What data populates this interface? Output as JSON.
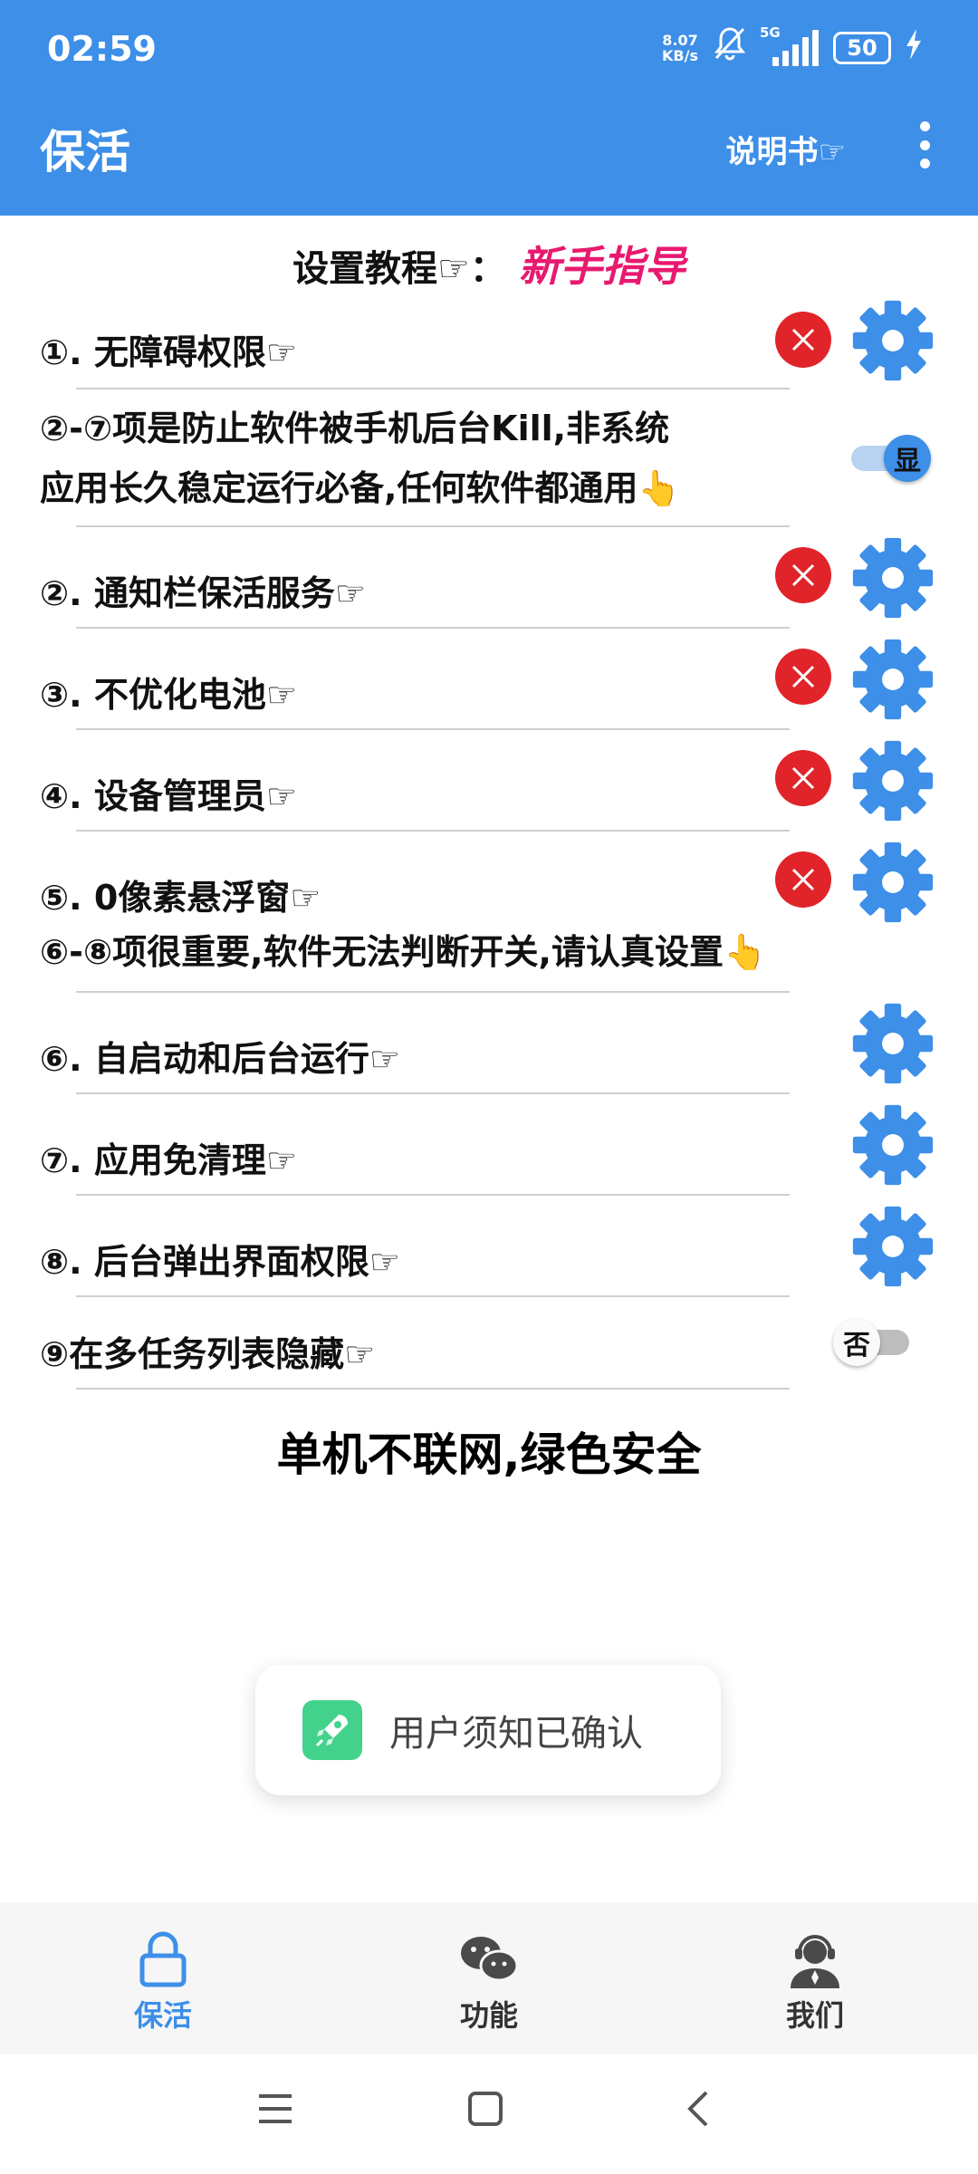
{
  "status": {
    "time": "02:59",
    "net_speed": "8.07",
    "net_unit": "KB/s",
    "signal_label": "5G",
    "battery": "50"
  },
  "header": {
    "title": "保活",
    "manual": "说明书☞"
  },
  "tutorial": {
    "label": "设置教程☞：",
    "guide": "新手指导"
  },
  "rows": {
    "r1": "①. 无障碍权限☞",
    "note1_line1": "②-⑦项是防止软件被手机后台Kill,非系统",
    "note1_line2": "应用长久稳定运行必备,任何软件都通用👆",
    "r2": "②. 通知栏保活服务☞",
    "r3": "③. 不优化电池☞",
    "r4": "④. 设备管理员☞",
    "r5": "⑤. 0像素悬浮窗☞",
    "note2": "⑥-⑧项很重要,软件无法判断开关,请认真设置👆",
    "r6": "⑥. 自启动和后台运行☞",
    "r7": "⑦. 应用免清理☞",
    "r8": "⑧. 后台弹出界面权限☞",
    "r9": "⑨在多任务列表隐藏☞"
  },
  "toggles": {
    "show": "显",
    "hide": "否"
  },
  "slogan": "单机不联网,绿色安全",
  "toast": "用户须知已确认",
  "nav": {
    "keepalive": "保活",
    "functions": "功能",
    "us": "我们"
  },
  "colors": {
    "primary": "#3d8fe8",
    "error": "#e0242a",
    "guide": "#e8196e",
    "toast_icon": "#43d28c"
  }
}
